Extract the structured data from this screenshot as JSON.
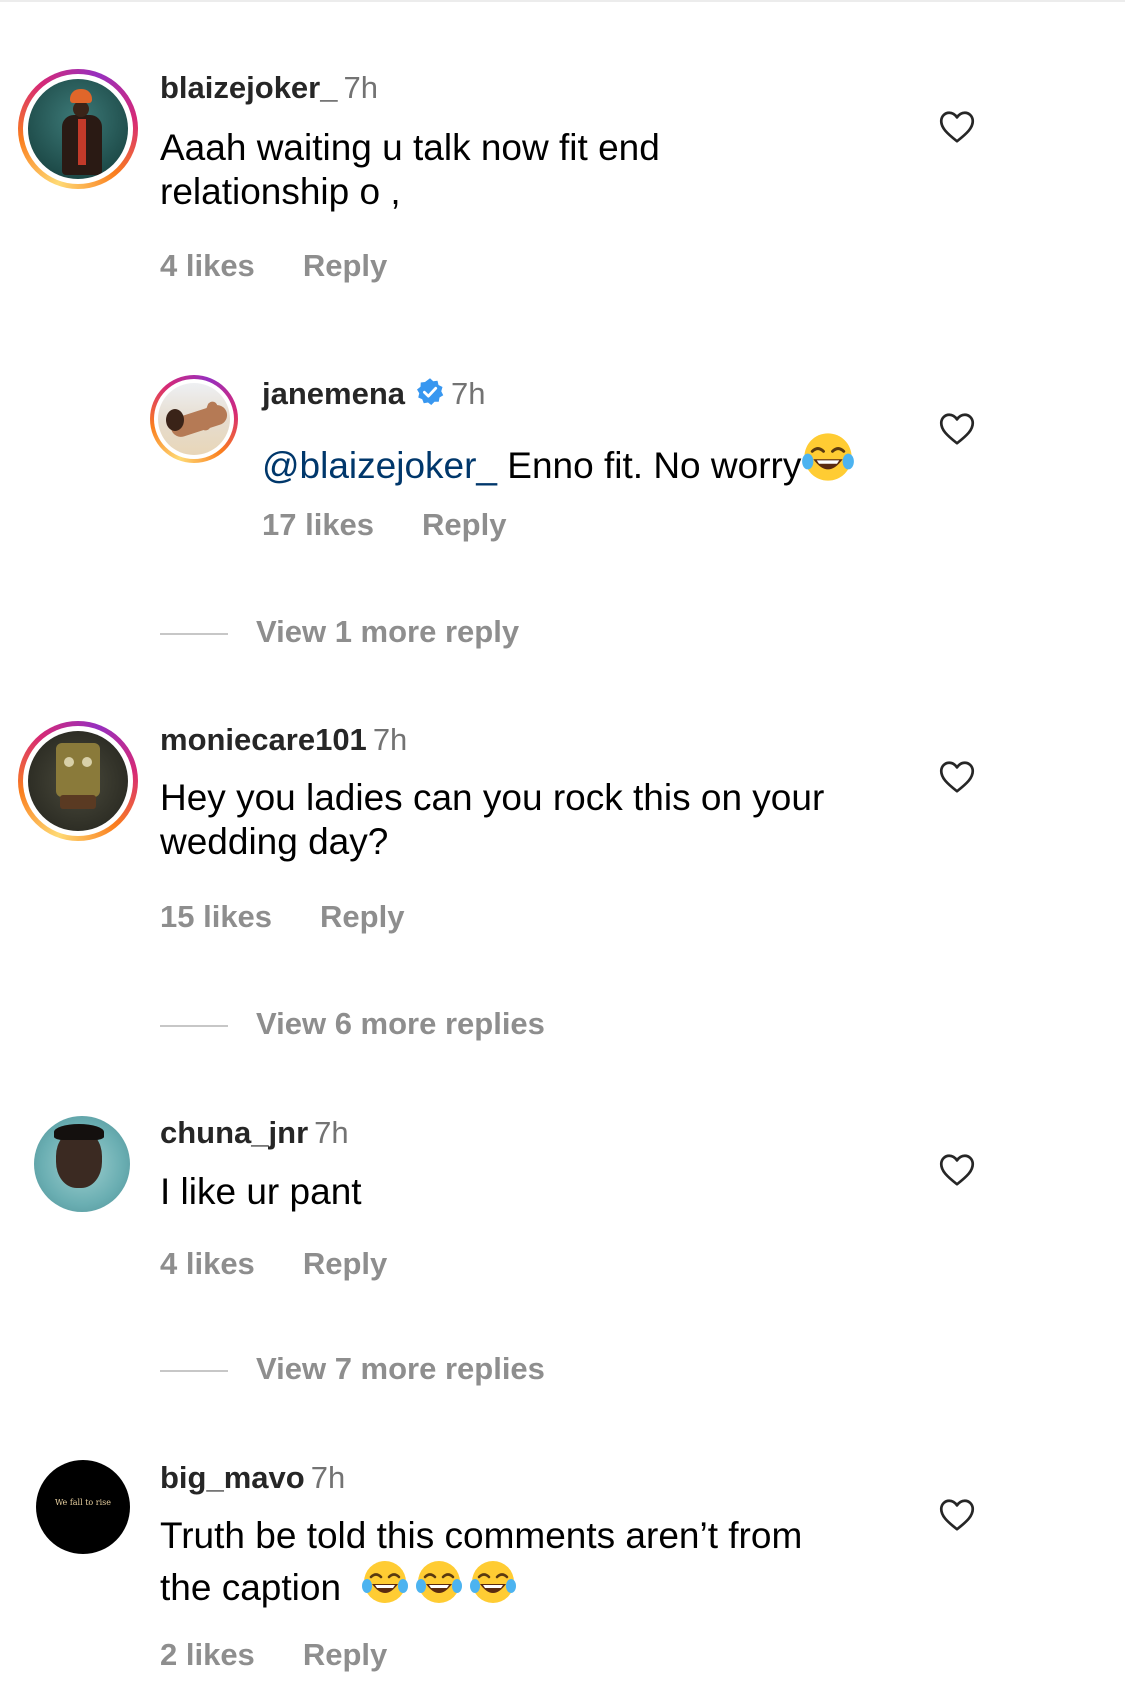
{
  "comments": [
    {
      "username": "blaizejoker_",
      "time": "7h",
      "text_line1": "Aaah waiting u talk now fit end",
      "text_line2": "relationship o ,",
      "likes": "4 likes",
      "reply": "Reply",
      "avatar": "story-ring-avatar"
    },
    {
      "username": "janemena",
      "verified": true,
      "time": "7h",
      "mention": "@blaizejoker_",
      "text": "Enno fit. No worry",
      "emoji": "face-with-tears-of-joy",
      "likes": "17 likes",
      "reply": "Reply"
    },
    {
      "username": "moniecare101",
      "time": "7h",
      "text_line1": "Hey you ladies can you rock this on your",
      "text_line2": "wedding day?",
      "likes": "15 likes",
      "reply": "Reply"
    },
    {
      "username": "chuna_jnr",
      "time": "7h",
      "text": "I like ur pant",
      "likes": "4 likes",
      "reply": "Reply"
    },
    {
      "username": "big_mavo",
      "time": "7h",
      "text_line1": "Truth be told this comments aren’t from",
      "text_line2": "the caption",
      "emoji_count": 3,
      "likes": "2 likes",
      "reply": "Reply",
      "avatar_text": "We fall to rise"
    }
  ],
  "view_more": {
    "first": "View 1 more reply",
    "second": "View 6 more replies",
    "third": "View 7 more replies"
  },
  "colors": {
    "username": "#262626",
    "meta": "#8e8e8e",
    "mention": "#00376b",
    "verified": "#3897f0"
  }
}
